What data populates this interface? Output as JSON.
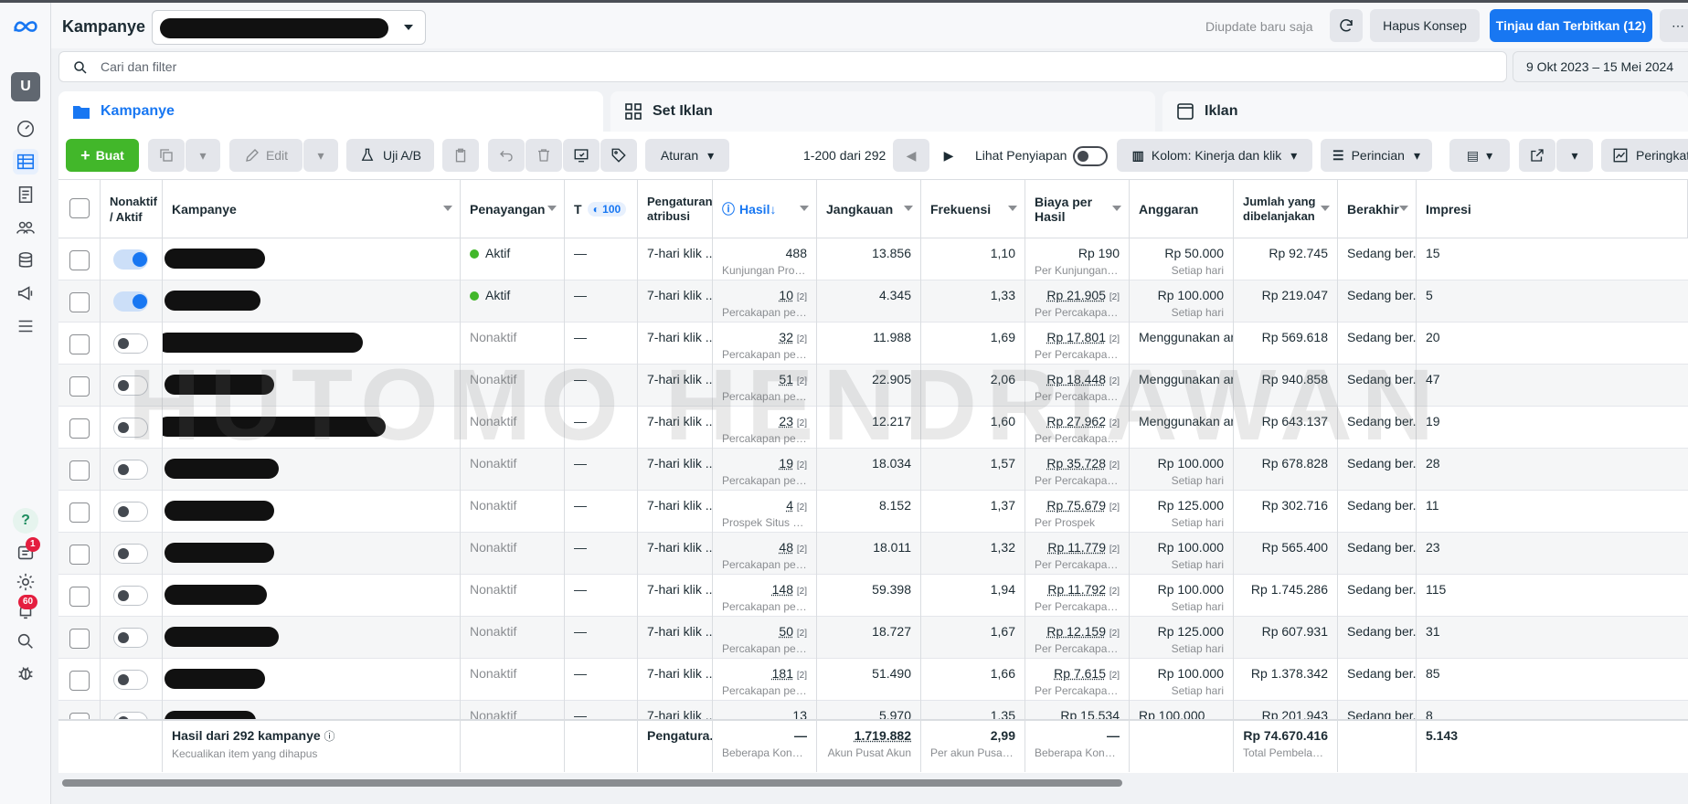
{
  "header": {
    "title": "Kampanye",
    "updated_text": "Diupdate baru saja",
    "discard_label": "Hapus Konsep",
    "publish_label": "Tinjau dan Terbitkan (12)"
  },
  "search": {
    "placeholder": "Cari dan filter"
  },
  "date_range": "9 Okt 2023 – 15 Mei 2024",
  "tabs": [
    {
      "label": "Kampanye"
    },
    {
      "label": "Set Iklan"
    },
    {
      "label": "Iklan"
    }
  ],
  "toolbar": {
    "create_label": "Buat",
    "edit_label": "Edit",
    "ab_label": "Uji A/B",
    "rules_label": "Aturan",
    "pagination": "1-200 dari 292",
    "preview_label": "Lihat Penyiapan",
    "columns_label": "Kolom: Kinerja dan klik",
    "breakdown_label": "Perincian",
    "ranking_label": "Peringkat"
  },
  "columns": {
    "onoff": "Nonaktif / Aktif",
    "campaign": "Kampanye",
    "delivery": "Penayangan",
    "t": "T",
    "t_value": "100",
    "attribution": "Pengaturan atribusi",
    "results": "Hasil",
    "reach": "Jangkauan",
    "frequency": "Frekuensi",
    "cpr": "Biaya per Hasil",
    "budget": "Anggaran",
    "spent": "Jumlah yang dibelanjakan",
    "ends": "Berakhir",
    "impressions": "Impresi"
  },
  "rows": [
    {
      "active": true,
      "delivery": "Aktif",
      "dash": "—",
      "attr": "7-hari klik ...",
      "result": "488",
      "result_note": "",
      "result_sub": "Kunjungan Profil Ins...",
      "reach": "13.856",
      "freq": "1,10",
      "cpr": "Rp 190",
      "cpr_note": "",
      "cpr_sub": "Per Kunjungan Profil...",
      "budget": "Rp 50.000",
      "budget_sub": "Setiap hari",
      "spent": "Rp 92.745",
      "ends": "Sedang ber...",
      "impr": "15"
    },
    {
      "active": true,
      "delivery": "Aktif",
      "dash": "—",
      "attr": "7-hari klik ...",
      "result": "10",
      "result_note": "[2]",
      "result_sub": "Percakapan pesa...",
      "reach": "4.345",
      "freq": "1,33",
      "cpr": "Rp 21.905",
      "cpr_note": "[2]",
      "cpr_sub": "Per Percakapan P...",
      "budget": "Rp 100.000",
      "budget_sub": "Setiap hari",
      "spent": "Rp 219.047",
      "ends": "Sedang ber...",
      "impr": "5"
    },
    {
      "active": false,
      "delivery": "Nonaktif",
      "dash": "—",
      "attr": "7-hari klik ...",
      "result": "32",
      "result_note": "[2]",
      "result_sub": "Percakapan pesa...",
      "reach": "11.988",
      "freq": "1,69",
      "cpr": "Rp 17.801",
      "cpr_note": "[2]",
      "cpr_sub": "Per Percakapan P...",
      "budget": "Menggunakan an...",
      "budget_sub": "",
      "spent": "Rp 569.618",
      "ends": "Sedang ber...",
      "impr": "20"
    },
    {
      "active": false,
      "delivery": "Nonaktif",
      "dash": "—",
      "attr": "7-hari klik ...",
      "result": "51",
      "result_note": "[2]",
      "result_sub": "Percakapan pesa...",
      "reach": "22.905",
      "freq": "2,06",
      "cpr": "Rp 18.448",
      "cpr_note": "[2]",
      "cpr_sub": "Per Percakapan P...",
      "budget": "Menggunakan an...",
      "budget_sub": "",
      "spent": "Rp 940.858",
      "ends": "Sedang ber...",
      "impr": "47"
    },
    {
      "active": false,
      "delivery": "Nonaktif",
      "dash": "—",
      "attr": "7-hari klik ...",
      "result": "23",
      "result_note": "[2]",
      "result_sub": "Percakapan pesa...",
      "reach": "12.217",
      "freq": "1,60",
      "cpr": "Rp 27.962",
      "cpr_note": "[2]",
      "cpr_sub": "Per Percakapan P...",
      "budget": "Menggunakan an...",
      "budget_sub": "",
      "spent": "Rp 643.137",
      "ends": "Sedang ber...",
      "impr": "19"
    },
    {
      "active": false,
      "delivery": "Nonaktif",
      "dash": "—",
      "attr": "7-hari klik ...",
      "result": "19",
      "result_note": "[2]",
      "result_sub": "Percakapan pesa...",
      "reach": "18.034",
      "freq": "1,57",
      "cpr": "Rp 35.728",
      "cpr_note": "[2]",
      "cpr_sub": "Per Percakapan P...",
      "budget": "Rp 100.000",
      "budget_sub": "Setiap hari",
      "spent": "Rp 678.828",
      "ends": "Sedang ber...",
      "impr": "28"
    },
    {
      "active": false,
      "delivery": "Nonaktif",
      "dash": "—",
      "attr": "7-hari klik ...",
      "result": "4",
      "result_note": "[2]",
      "result_sub": "Prospek Situs Web",
      "reach": "8.152",
      "freq": "1,37",
      "cpr": "Rp 75.679",
      "cpr_note": "[2]",
      "cpr_sub": "Per Prospek",
      "budget": "Rp 125.000",
      "budget_sub": "Setiap hari",
      "spent": "Rp 302.716",
      "ends": "Sedang ber...",
      "impr": "11"
    },
    {
      "active": false,
      "delivery": "Nonaktif",
      "dash": "—",
      "attr": "7-hari klik ...",
      "result": "48",
      "result_note": "[2]",
      "result_sub": "Percakapan pesa...",
      "reach": "18.011",
      "freq": "1,32",
      "cpr": "Rp 11.779",
      "cpr_note": "[2]",
      "cpr_sub": "Per Percakapan P...",
      "budget": "Rp 100.000",
      "budget_sub": "Setiap hari",
      "spent": "Rp 565.400",
      "ends": "Sedang ber...",
      "impr": "23"
    },
    {
      "active": false,
      "delivery": "Nonaktif",
      "dash": "—",
      "attr": "7-hari klik ...",
      "result": "148",
      "result_note": "[2]",
      "result_sub": "Percakapan pesa...",
      "reach": "59.398",
      "freq": "1,94",
      "cpr": "Rp 11.792",
      "cpr_note": "[2]",
      "cpr_sub": "Per Percakapan P...",
      "budget": "Rp 100.000",
      "budget_sub": "Setiap hari",
      "spent": "Rp 1.745.286",
      "ends": "Sedang ber...",
      "impr": "115"
    },
    {
      "active": false,
      "delivery": "Nonaktif",
      "dash": "—",
      "attr": "7-hari klik ...",
      "result": "50",
      "result_note": "[2]",
      "result_sub": "Percakapan pesa...",
      "reach": "18.727",
      "freq": "1,67",
      "cpr": "Rp 12.159",
      "cpr_note": "[2]",
      "cpr_sub": "Per Percakapan P...",
      "budget": "Rp 125.000",
      "budget_sub": "Setiap hari",
      "spent": "Rp 607.931",
      "ends": "Sedang ber...",
      "impr": "31"
    },
    {
      "active": false,
      "delivery": "Nonaktif",
      "dash": "—",
      "attr": "7-hari klik ...",
      "result": "181",
      "result_note": "[2]",
      "result_sub": "Percakapan pesa...",
      "reach": "51.490",
      "freq": "1,66",
      "cpr": "Rp 7.615",
      "cpr_note": "[2]",
      "cpr_sub": "Per Percakapan P...",
      "budget": "Rp 100.000",
      "budget_sub": "Setiap hari",
      "spent": "Rp 1.378.342",
      "ends": "Sedang ber...",
      "impr": "85"
    },
    {
      "active": false,
      "delivery": "Nonaktif",
      "dash": "—",
      "attr": "7-hari klik ...",
      "result": "13",
      "result_note": "",
      "result_sub": "",
      "reach": "5.970",
      "freq": "1,35",
      "cpr": "Rp 15.534",
      "cpr_note": "",
      "cpr_sub": "",
      "budget": "Rp 100.000",
      "budget_sub": "",
      "spent": "Rp 201.943",
      "ends": "Sedang ber...",
      "impr": "8"
    }
  ],
  "footer": {
    "title": "Hasil dari 292 kampanye",
    "subtitle": "Kecualikan item yang dihapus",
    "attribution": "Pengatura...",
    "results": "—",
    "results_sub": "Beberapa Konversi",
    "reach": "1.719.882",
    "reach_sub": "Akun Pusat Akun",
    "freq": "2,99",
    "freq_sub": "Per akun Pusat Akun",
    "cpr": "—",
    "cpr_sub": "Beberapa Konversi",
    "spent": "Rp 74.670.416",
    "spent_sub": "Total Pembelanjaan",
    "impr": "5.143"
  },
  "watermark": "HUTOMO HENDRIAWAN",
  "sidebar": {
    "avatar_letter": "U",
    "notifications_badge": "1",
    "alerts_badge": "60"
  },
  "colors": {
    "accent": "#1877f2",
    "create": "#42b72a",
    "active_dot": "#42b72a",
    "badge": "#e41e3f"
  }
}
